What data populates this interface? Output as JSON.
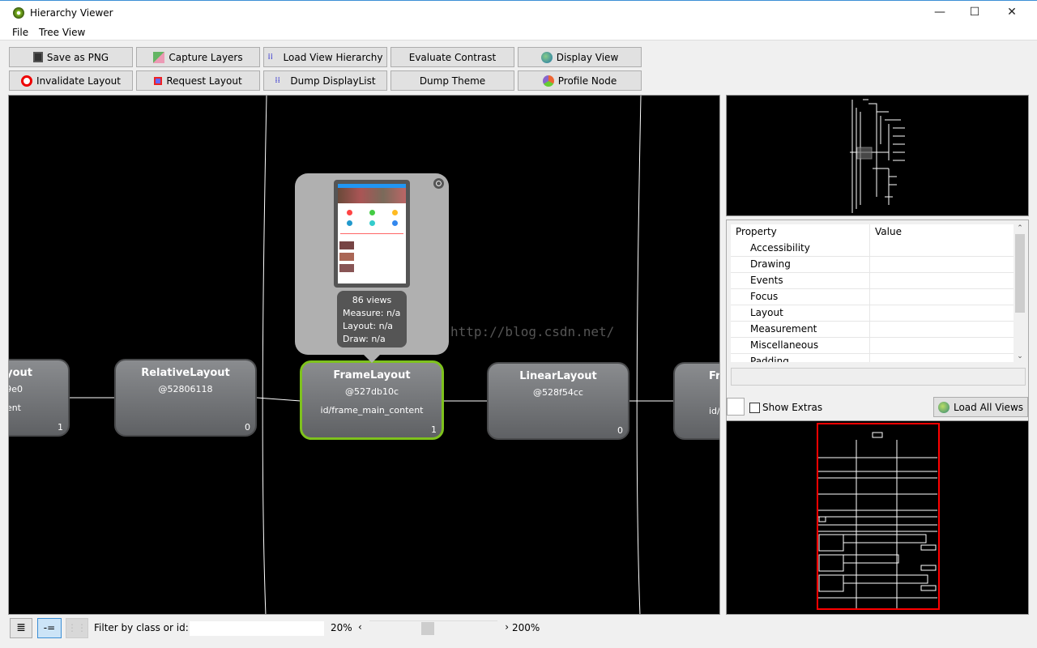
{
  "window": {
    "title": "Hierarchy Viewer",
    "controls": [
      "—",
      "☐",
      "✕"
    ]
  },
  "menu": [
    {
      "label": "File"
    },
    {
      "label": "Tree View"
    }
  ],
  "toolbar": {
    "row1": [
      {
        "label": "Save as PNG",
        "icon": "floppy-icon"
      },
      {
        "label": "Capture Layers",
        "icon": "layers-icon"
      },
      {
        "label": "Load View Hierarchy",
        "icon": "tree-icon"
      },
      {
        "label": "Evaluate Contrast",
        "icon": ""
      },
      {
        "label": "Display View",
        "icon": "globe-icon"
      }
    ],
    "row2": [
      {
        "label": "Invalidate Layout",
        "icon": "no-entry-icon"
      },
      {
        "label": "Request Layout",
        "icon": "request-layout-icon"
      },
      {
        "label": "Dump DisplayList",
        "icon": "tree-icon"
      },
      {
        "label": "Dump Theme",
        "icon": ""
      },
      {
        "label": "Profile Node",
        "icon": "profile-icon"
      }
    ]
  },
  "tree": {
    "nodes": [
      {
        "name": "yout",
        "hash": "9e0",
        "id": "ent",
        "count": "1"
      },
      {
        "name": "RelativeLayout",
        "hash": "@52806118",
        "id": "",
        "count": "0"
      },
      {
        "name": "FrameLayout",
        "hash": "@527db10c",
        "id": "id/frame_main_content",
        "count": "1",
        "selected": true
      },
      {
        "name": "LinearLayout",
        "hash": "@528f54cc",
        "id": "",
        "count": "0"
      },
      {
        "name": "Fr",
        "hash": "(",
        "id": "id/",
        "count": ""
      }
    ],
    "popup": {
      "views": "86 views",
      "measure": "Measure: n/a",
      "layout": "Layout: n/a",
      "draw": "Draw: n/a"
    },
    "watermark": "http://blog.csdn.net/"
  },
  "properties": {
    "headers": [
      "Property",
      "Value"
    ],
    "rows": [
      "Accessibility",
      "Drawing",
      "Events",
      "Focus",
      "Layout",
      "Measurement",
      "Miscellaneous",
      "Padding"
    ],
    "show_extras": "Show Extras",
    "load_all_views": "Load All Views"
  },
  "status": {
    "filter_label": "Filter by class or id:",
    "filter_value": "",
    "zoom_min": "20%",
    "zoom_max": "200%",
    "zoom_level": 0.45
  },
  "colors": {
    "selected_border": "#7ec21d",
    "layout_box": "#ff0000"
  }
}
